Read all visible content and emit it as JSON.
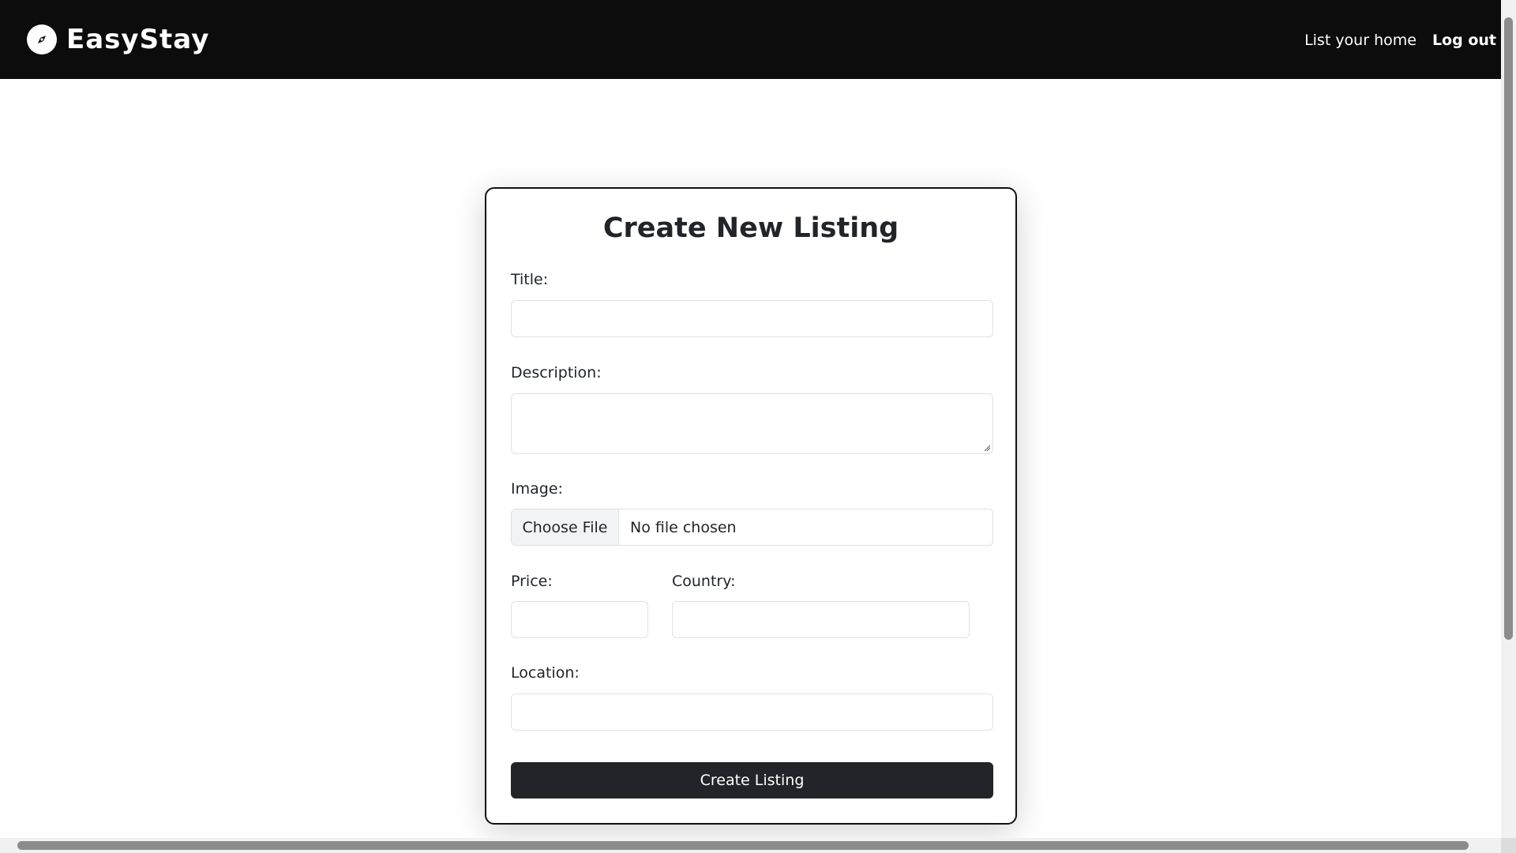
{
  "navbar": {
    "brand_name": "EasyStay",
    "brand_icon": "compass-icon",
    "links": [
      {
        "label": "List your home"
      },
      {
        "label": "Log out"
      }
    ]
  },
  "form": {
    "heading": "Create New Listing",
    "title_label": "Title:",
    "title_value": "",
    "description_label": "Description:",
    "description_value": "",
    "image_label": "Image:",
    "file_button_label": "Choose File",
    "file_status": "No file chosen",
    "price_label": "Price:",
    "price_value": "",
    "country_label": "Country:",
    "country_value": "",
    "location_label": "Location:",
    "location_value": "",
    "submit_label": "Create Listing"
  },
  "colors": {
    "navbar_bg": "#0c0c0c",
    "button_bg": "#212529",
    "input_border": "#dee2e6"
  }
}
